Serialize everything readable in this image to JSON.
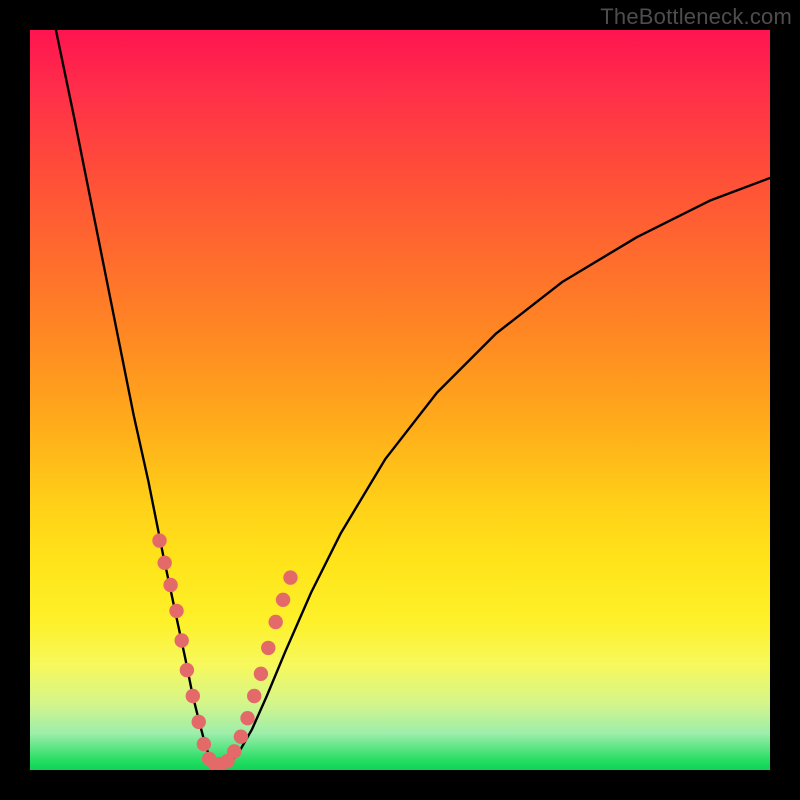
{
  "attribution": "TheBottleneck.com",
  "colors": {
    "curve_stroke": "#000000",
    "marker_fill": "#e46a6a",
    "marker_stroke": "#c25a5a",
    "gradient_top": "#ff1450",
    "gradient_bottom": "#12d25a",
    "frame": "#000000"
  },
  "chart_data": {
    "type": "line",
    "title": "",
    "xlabel": "",
    "ylabel": "",
    "xlim": [
      0,
      100
    ],
    "ylim": [
      0,
      100
    ],
    "notes": "Axes are unlabeled in the source image; values below are read off pixel positions as percentages of the plot area. y=0 is the bottom (best / green), y=100 is the top (worst / red). The two curves form a V meeting near the bottom.",
    "series": [
      {
        "name": "left-curve",
        "x": [
          3.5,
          6,
          8,
          10,
          12,
          14,
          16,
          18,
          19.5,
          21,
          22,
          23,
          23.8,
          24.5,
          25
        ],
        "y": [
          100,
          88,
          78,
          68,
          58,
          48,
          39,
          29,
          22,
          15,
          10,
          6,
          3,
          1.3,
          0.6
        ]
      },
      {
        "name": "right-curve",
        "x": [
          26.5,
          28,
          30,
          32,
          34.5,
          38,
          42,
          48,
          55,
          63,
          72,
          82,
          92,
          100
        ],
        "y": [
          0.6,
          2,
          5.5,
          10,
          16,
          24,
          32,
          42,
          51,
          59,
          66,
          72,
          77,
          80
        ]
      }
    ],
    "markers": {
      "name": "data-points",
      "points_xy": [
        [
          17.5,
          31
        ],
        [
          18.2,
          28
        ],
        [
          19,
          25
        ],
        [
          19.8,
          21.5
        ],
        [
          20.5,
          17.5
        ],
        [
          21.2,
          13.5
        ],
        [
          22,
          10
        ],
        [
          22.8,
          6.5
        ],
        [
          23.5,
          3.5
        ],
        [
          24.2,
          1.5
        ],
        [
          25,
          0.8
        ],
        [
          25.8,
          0.8
        ],
        [
          26.7,
          1.2
        ],
        [
          27.6,
          2.5
        ],
        [
          28.5,
          4.5
        ],
        [
          29.4,
          7
        ],
        [
          30.3,
          10
        ],
        [
          31.2,
          13
        ],
        [
          32.2,
          16.5
        ],
        [
          33.2,
          20
        ],
        [
          34.2,
          23
        ],
        [
          35.2,
          26
        ]
      ]
    }
  }
}
